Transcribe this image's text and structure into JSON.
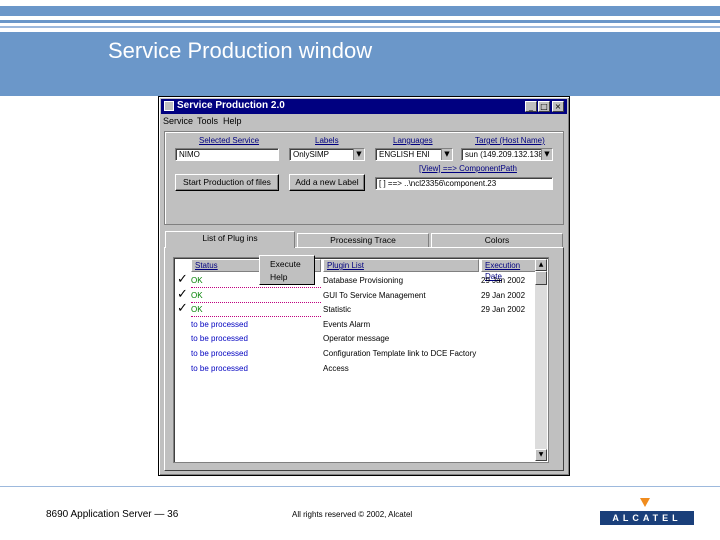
{
  "slide": {
    "title": "Service Production window",
    "footer_left": "8690 Application Server — 36",
    "footer_center": "All rights reserved © 2002, Alcatel",
    "logo_text": "ALCATEL"
  },
  "window": {
    "title": "Service Production 2.0",
    "controls": [
      "_",
      "□",
      "×"
    ],
    "menu": [
      "Service",
      "Tools",
      "Help"
    ]
  },
  "form": {
    "selected_service_label": "Selected Service",
    "selected_service_value": "NIMO",
    "labels_label": "Labels",
    "labels_value": "OnlySIMP",
    "languages_label": "Languages",
    "languages_value": "ENGLISH ENI",
    "target_label": "Target (Host Name)",
    "target_value": "sun (149.209.132.138)",
    "view_path_label": "[View] ==> ComponentPath",
    "view_path_value": "[ ] ==> ..\\ncl23356\\component.23",
    "start_button": "Start Production of files",
    "add_label_button": "Add a new Label"
  },
  "tabs": [
    "List of Plug ins",
    "Processing Trace",
    "Colors"
  ],
  "list": {
    "headers": {
      "status": "Status",
      "plugin": "Plugin List",
      "date": "Execution Date"
    },
    "rows": [
      {
        "status": "OK",
        "plugin": "Database Provisioning",
        "date": "29 Jan 2002",
        "checked": true,
        "kind": "ok"
      },
      {
        "status": "OK",
        "plugin": "GUI To Service Management",
        "date": "29 Jan 2002",
        "checked": true,
        "kind": "ok"
      },
      {
        "status": "OK",
        "plugin": "Statistic",
        "date": "29 Jan 2002",
        "checked": true,
        "kind": "ok"
      },
      {
        "status": "to be processed",
        "plugin": "Events Alarm",
        "date": "",
        "checked": false,
        "kind": "todo"
      },
      {
        "status": "to be processed",
        "plugin": "Operator message",
        "date": "",
        "checked": false,
        "kind": "todo"
      },
      {
        "status": "to be processed",
        "plugin": "Configuration Template link to DCE Factory",
        "date": "",
        "checked": false,
        "kind": "todo"
      },
      {
        "status": "to be processed",
        "plugin": "Access",
        "date": "",
        "checked": false,
        "kind": "todo"
      }
    ]
  },
  "context_menu": [
    "Execute",
    "Help"
  ],
  "icons": {
    "checked": "check-icon",
    "dropdown": "chevron-down-icon"
  },
  "colors": {
    "header_blue": "#6b97c9",
    "titlebar": "#000080",
    "ok_green": "#008000",
    "todo_blue": "#0000c0"
  }
}
